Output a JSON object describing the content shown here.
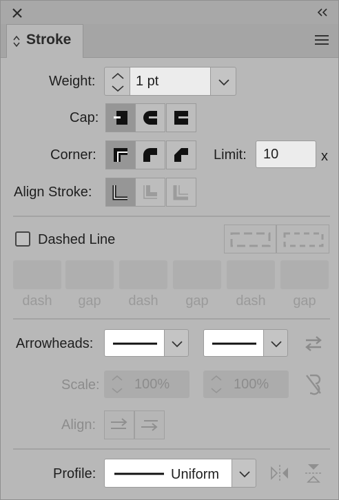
{
  "tab_title": "Stroke",
  "weight": {
    "label": "Weight:",
    "value": "1 pt"
  },
  "cap": {
    "label": "Cap:"
  },
  "corner": {
    "label": "Corner:"
  },
  "limit": {
    "label": "Limit:",
    "value": "10",
    "suffix": "x"
  },
  "align_stroke": {
    "label": "Align Stroke:"
  },
  "dashed_line": {
    "label": "Dashed Line",
    "checked": false
  },
  "dash_gap_labels": [
    "dash",
    "gap",
    "dash",
    "gap",
    "dash",
    "gap"
  ],
  "arrowheads": {
    "label": "Arrowheads:"
  },
  "scale": {
    "label": "Scale:",
    "start": "100%",
    "end": "100%"
  },
  "align": {
    "label": "Align:"
  },
  "profile": {
    "label": "Profile:",
    "value": "Uniform"
  }
}
